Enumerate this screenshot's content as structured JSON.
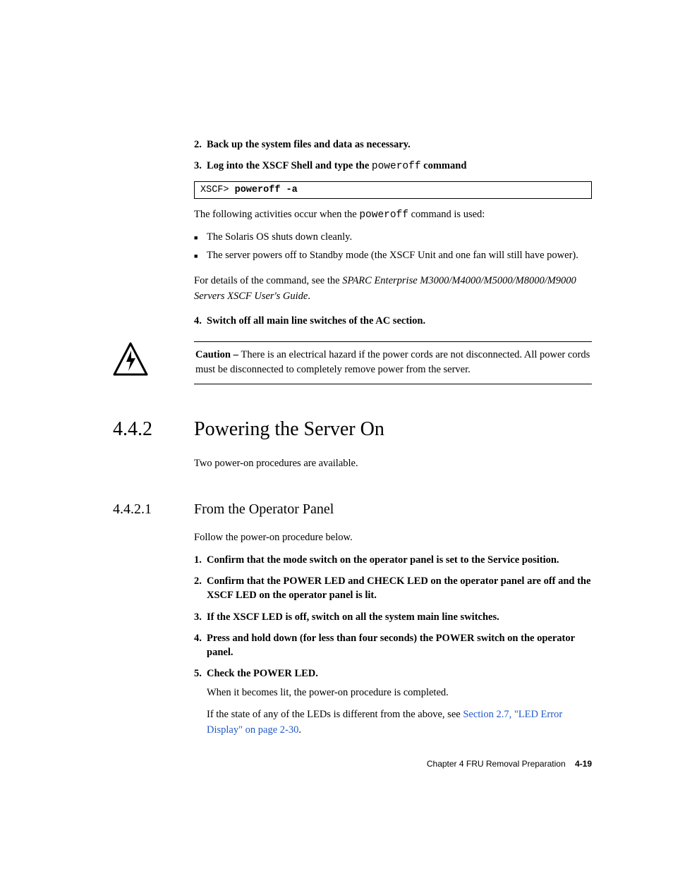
{
  "steps_top": {
    "s2": {
      "num": "2.",
      "text": "Back up the system files and data as necessary."
    },
    "s3": {
      "num": "3.",
      "prefix": "Log into the XSCF Shell and type the ",
      "code": "poweroff",
      "suffix": " command"
    }
  },
  "codebox": {
    "prompt": "XSCF> ",
    "cmd": "poweroff -a"
  },
  "para_after_code": {
    "pre": "The following activities occur when the ",
    "code": "poweroff",
    "post": " command is used:"
  },
  "bullets": {
    "b1": "The Solaris OS shuts down cleanly.",
    "b2": "The server powers off to Standby mode (the XSCF Unit and one fan will still have power)."
  },
  "details_para": {
    "pre": "For details of the command, see the ",
    "italic": "SPARC Enterprise M3000/M4000/M5000/M8000/M9000 Servers XSCF User's Guide",
    "post": "."
  },
  "step4": {
    "num": "4.",
    "text": "Switch off all main line switches of the AC section."
  },
  "caution": {
    "label": "Caution – ",
    "text": "There is an electrical hazard if the power cords are not disconnected. All power cords must be disconnected to completely remove power from the server."
  },
  "h2": {
    "num": "4.4.2",
    "title": "Powering the Server On"
  },
  "h2_intro": "Two power-on procedures are available.",
  "h3": {
    "num": "4.4.2.1",
    "title": "From the Operator Panel"
  },
  "h3_intro": "Follow the power-on procedure below.",
  "steps_bottom": {
    "s1": {
      "num": "1.",
      "text": "Confirm that the mode switch on the operator panel is set to the Service position."
    },
    "s2": {
      "num": "2.",
      "text": "Confirm that the POWER LED and CHECK LED on the operator panel are off and the XSCF LED on the operator panel is lit."
    },
    "s3": {
      "num": "3.",
      "text": "If the XSCF LED is off, switch on all the system main line switches."
    },
    "s4": {
      "num": "4.",
      "text": "Press and hold down (for less than four seconds) the POWER switch on the operator panel."
    },
    "s5": {
      "num": "5.",
      "text": "Check the POWER LED."
    },
    "s5_body1": "When it becomes lit, the power-on procedure is completed.",
    "s5_body2_pre": "If the state of any of the LEDs is different from the above, see ",
    "s5_body2_link": "Section 2.7, \"LED Error Display\" on page 2-30",
    "s5_body2_post": "."
  },
  "footer": {
    "chapter": "Chapter 4    FRU Removal Preparation",
    "page": "4-19"
  }
}
